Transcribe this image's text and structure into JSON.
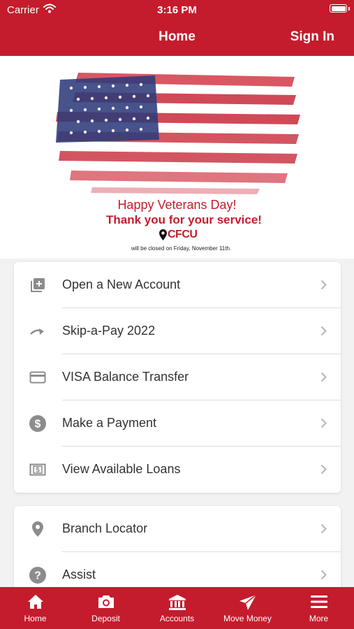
{
  "status_bar": {
    "carrier": "Carrier",
    "time": "3:16 PM"
  },
  "nav": {
    "title": "Home",
    "sign_in": "Sign In"
  },
  "banner": {
    "headline": "Happy Veterans Day!",
    "subheadline": "Thank you for your service!",
    "logo_text": "CFCU",
    "note": "will be closed on Friday, November 11th."
  },
  "menu_primary": [
    {
      "label": "Open a New Account",
      "icon": "add-box-icon"
    },
    {
      "label": "Skip-a-Pay 2022",
      "icon": "redo-arrow-icon"
    },
    {
      "label": "VISA Balance Transfer",
      "icon": "credit-card-icon"
    },
    {
      "label": "Make a Payment",
      "icon": "dollar-circle-icon"
    },
    {
      "label": "View Available Loans",
      "icon": "money-bill-icon"
    }
  ],
  "menu_secondary": [
    {
      "label": "Branch Locator",
      "icon": "location-pin-icon"
    },
    {
      "label": "Assist",
      "icon": "help-circle-icon"
    }
  ],
  "tabs": [
    {
      "label": "Home",
      "icon": "home-icon"
    },
    {
      "label": "Deposit",
      "icon": "camera-icon"
    },
    {
      "label": "Accounts",
      "icon": "bank-icon"
    },
    {
      "label": "Move Money",
      "icon": "send-icon"
    },
    {
      "label": "More",
      "icon": "menu-icon"
    }
  ],
  "colors": {
    "brand": "#c41c2d",
    "icon_gray": "#8c8c8c",
    "flag_blue": "#2e3b7a"
  }
}
